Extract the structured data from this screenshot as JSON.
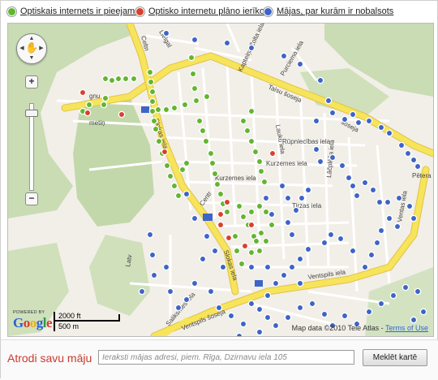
{
  "legend": {
    "available_label": "Optiskais internets ir pieejams",
    "planned_label": "Optisko internetu plāno ierīkot",
    "voted_label": "Mājas, par kurām ir nobalsots",
    "available_color": "#62b530",
    "planned_color": "#d9402e",
    "voted_color": "#3d64c8"
  },
  "map": {
    "streets": {
      "talsu": "Talsu šoseja",
      "kurzemes": "Kurzemes iela",
      "kurzemes2": "Kurzemes iela",
      "rupnieciba": "Rūpniecības iela",
      "ventspils_iela": "Ventspils iela",
      "ventspils_soseja": "Ventspils šoseja",
      "saliksmes": "Saliksmes iela",
      "slokas": "Slokas iela",
      "slokas2": "Slokas iela",
      "tirzas": "Tirzas iela",
      "lacplesa": "Lāčplēša iela",
      "kapteinu": "Kapteiņa Zolta iela",
      "purciema": "Purciema iela",
      "lauku": "Lauku iela",
      "jurmalas": "Juras iela",
      "petera": "Pētera",
      "ventas": "Ventas iela",
      "sosa": "šoseja",
      "celtn": "Celtn",
      "lielgal": "Lielgal",
      "mety": "metiņ",
      "gnu": "gnu",
      "sk": "Sk",
      "lat": "Latv",
      "cent": "Centr"
    },
    "scale": {
      "ft": "2000 ft",
      "m": "500 m"
    },
    "powered_by": "POWERED BY",
    "google": "Google",
    "copyright": "Map data ©2010 Tele Atlas -",
    "terms": "Terms of Use"
  },
  "search": {
    "title": "Atrodi savu māju",
    "placeholder": "Ieraksti mājas adresi, piem. Rīga, Dzirnavu iela 105",
    "button": "Meklēt kartē"
  }
}
